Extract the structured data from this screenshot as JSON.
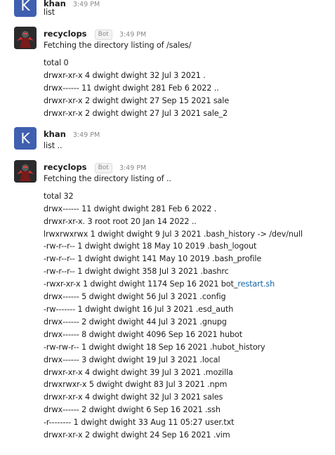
{
  "messages": [
    {
      "user": "khan",
      "avatar_letter": "K",
      "time": "3:49 PM",
      "lines": [
        "list"
      ]
    },
    {
      "user": "recyclops",
      "badge": "Bot",
      "time": "3:49 PM",
      "intro": "Fetching the directory listing of /sales/",
      "lines": [
        "total 0",
        "drwxr-xr-x 4 dwight dwight 32 Jul 3 2021 .",
        "drwx------ 11 dwight dwight 281 Feb 6 2022 ..",
        "drwxr-xr-x 2 dwight dwight 27 Sep 15 2021 sale",
        "drwxr-xr-x 2 dwight dwight 27 Jul 3 2021 sale_2"
      ]
    },
    {
      "user": "khan",
      "avatar_letter": "K",
      "time": "3:49 PM",
      "lines": [
        "list .."
      ]
    },
    {
      "user": "recyclops",
      "badge": "Bot",
      "time": "3:49 PM",
      "intro": "Fetching the directory listing of ..",
      "lines": [
        "total 32",
        "drwx------ 11 dwight dwight 281 Feb 6 2022 .",
        "drwxr-xr-x. 3 root root 20 Jan 14 2022 ..",
        "lrwxrwxrwx 1 dwight dwight 9 Jul 3 2021 .bash_history -> /dev/null",
        "-rw-r--r-- 1 dwight dwight 18 May 10 2019 .bash_logout",
        "-rw-r--r-- 1 dwight dwight 141 May 10 2019 .bash_profile",
        "-rw-r--r-- 1 dwight dwight 358 Jul 3 2021 .bashrc",
        "-rwxr-xr-x 1 dwight dwight 1174 Sep 16 2021 bot_",
        "drwx------ 5 dwight dwight 56 Jul 3 2021 .config",
        "-rw------- 1 dwight dwight 16 Jul 3 2021 .esd_auth",
        "drwx------ 2 dwight dwight 44 Jul 3 2021 .gnupg",
        "drwx------ 8 dwight dwight 4096 Sep 16 2021 hubot",
        "-rw-rw-r-- 1 dwight dwight 18 Sep 16 2021 .hubot_history",
        "drwx------ 3 dwight dwight 19 Jul 3 2021 .local",
        "drwxr-xr-x 4 dwight dwight 39 Jul 3 2021 .mozilla",
        "drwxrwxr-x 5 dwight dwight 83 Jul 3 2021 .npm",
        "drwxr-xr-x 4 dwight dwight 32 Jul 3 2021 sales",
        "drwx------ 2 dwight dwight 6 Sep 16 2021 .ssh",
        "-r-------- 1 dwight dwight 33 Aug 11 05:27 user.txt",
        "drwxr-xr-x 2 dwight dwight 24 Sep 16 2021 .vim"
      ],
      "link_text": "restart.sh"
    }
  ]
}
